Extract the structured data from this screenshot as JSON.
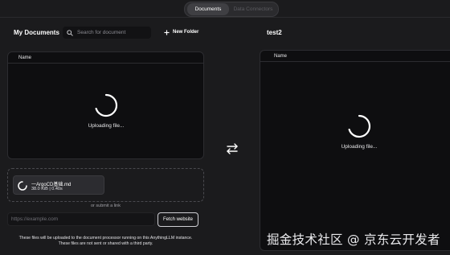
{
  "tabs": [
    {
      "label": "Documents",
      "active": true
    },
    {
      "label": "Data Connectors",
      "active": false
    }
  ],
  "left": {
    "title": "My Documents",
    "search": {
      "placeholder": "Search for document",
      "value": ""
    },
    "new_folder_label": "New Folder",
    "table": {
      "header_name": "Name",
      "status": "Uploading file..."
    }
  },
  "upload": {
    "file": {
      "name": "一ArgoCD基础.md",
      "meta": "38.0 KiB | 0.40s"
    },
    "or_link": "or submit a link",
    "url_input": {
      "placeholder": "https://example.com",
      "value": ""
    },
    "fetch_label": "Fetch website",
    "notice_line1": "These files will be uploaded to the document processor running on this AnythingLLM instance.",
    "notice_line2": "These files are not sent or shared with a third party."
  },
  "right": {
    "title": "test2",
    "table": {
      "header_name": "Name",
      "status": "Uploading file..."
    }
  },
  "watermark": "掘金技术社区 @ 京东云开发者",
  "icons": {
    "search": "search-icon",
    "plus": "plus-icon",
    "swap": "swap-arrows-icon",
    "spinner": "spinner-icon"
  },
  "colors": {
    "background": "#1b1b1d",
    "panel": "#0e0e10",
    "accent": "#ffffff"
  }
}
